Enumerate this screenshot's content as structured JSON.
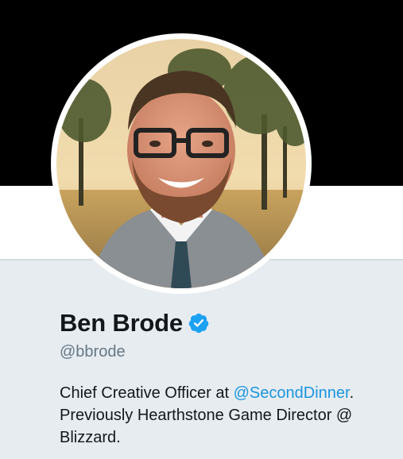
{
  "profile": {
    "name": "Ben Brode",
    "handle": "@bbrode",
    "verified": true,
    "bio": {
      "part1": "Chief Creative Officer at ",
      "mention": "@SecondDinner",
      "part2": ". Previously Hearthstone Game Director @ Blizzard."
    }
  },
  "icons": {
    "verified": "verified-badge-icon"
  },
  "colors": {
    "banner": "#000000",
    "page_background": "#e6ecf0",
    "name_text": "#14171a",
    "handle_text": "#657786",
    "link": "#1b95e0",
    "verified_badge": "#1da1f2"
  }
}
